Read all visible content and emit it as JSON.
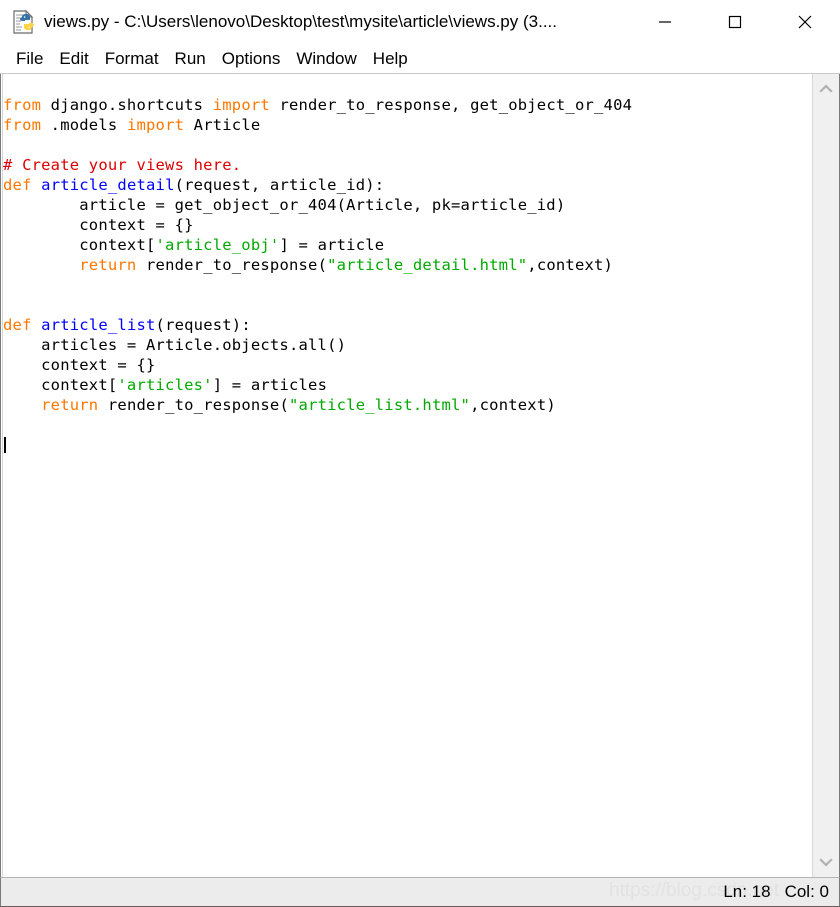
{
  "window": {
    "title": "views.py - C:\\Users\\lenovo\\Desktop\\test\\mysite\\article\\views.py (3....",
    "icon": "python-file-icon",
    "controls": {
      "minimize": "minimize-button",
      "maximize": "maximize-button",
      "close": "close-button"
    }
  },
  "menubar": {
    "items": [
      {
        "label": "File"
      },
      {
        "label": "Edit"
      },
      {
        "label": "Format"
      },
      {
        "label": "Run"
      },
      {
        "label": "Options"
      },
      {
        "label": "Window"
      },
      {
        "label": "Help"
      }
    ]
  },
  "editor": {
    "lines": [
      "from django.shortcuts import render_to_response, get_object_or_404",
      "from .models import Article",
      "",
      "# Create your views here.",
      "def article_detail(request, article_id):",
      "        article = get_object_or_404(Article, pk=article_id)",
      "        context = {}",
      "        context['article_obj'] = article",
      "        return render_to_response(\"article_detail.html\",context)",
      "",
      "",
      "def article_list(request):",
      "    articles = Article.objects.all()",
      "    context = {}",
      "    context['articles'] = articles",
      "    return render_to_response(\"article_list.html\",context)",
      "",
      ""
    ],
    "cursor_line": 18,
    "colors": {
      "keyword": "#ff7700",
      "definition": "#0000ff",
      "string": "#00aa00",
      "comment": "#dd0000",
      "builtin": "#900090",
      "text": "#000000",
      "background": "#ffffff"
    }
  },
  "scrollbar": {
    "up_arrow": "scroll-up-arrow",
    "down_arrow": "scroll-down-arrow"
  },
  "statusbar": {
    "line_label": "Ln: 18",
    "col_label": "Col: 0",
    "watermark": "https://blog.csdn.net"
  }
}
